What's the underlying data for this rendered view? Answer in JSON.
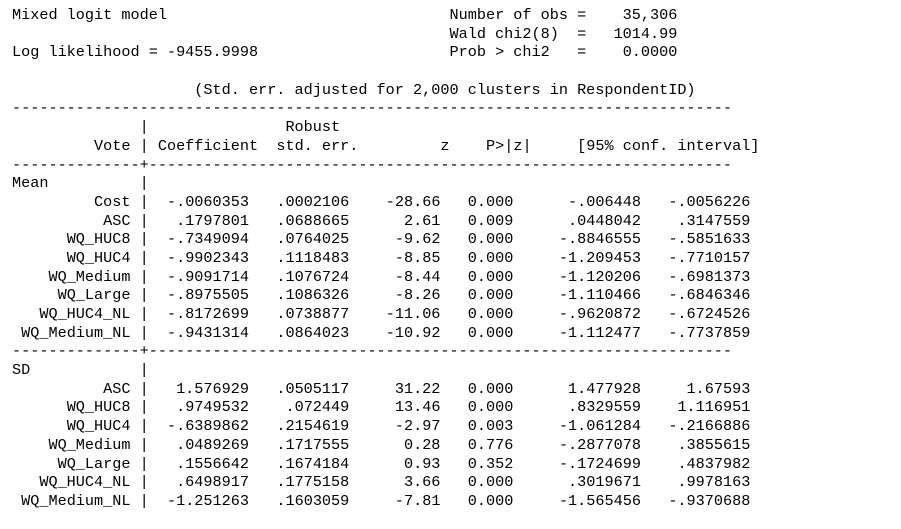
{
  "header": {
    "model_title": "Mixed logit model",
    "log_likelihood_label": "Log likelihood",
    "log_likelihood_value": "-9455.9998",
    "stats": [
      {
        "label": "Number of obs",
        "value": "35,306"
      },
      {
        "label": "Wald chi2(8)",
        "value": "1014.99"
      },
      {
        "label": "Prob > chi2",
        "value": "0.0000"
      }
    ],
    "cluster_note": "(Std. err. adjusted for 2,000 clusters in RespondentID)"
  },
  "table": {
    "depvar": "Vote",
    "col_headers": {
      "coef": "Coefficient",
      "robust": "Robust",
      "se": "std. err.",
      "z": "z",
      "p": "P>|z|",
      "ci": "[95% conf. interval]"
    },
    "sections": [
      {
        "name": "Mean",
        "rows": [
          {
            "var": "Cost",
            "coef": "-.0060353",
            "se": ".0002106",
            "z": "-28.66",
            "p": "0.000",
            "lo": "-.006448",
            "hi": "-.0056226"
          },
          {
            "var": "ASC",
            "coef": ".1797801",
            "se": ".0688665",
            "z": "2.61",
            "p": "0.009",
            "lo": ".0448042",
            "hi": ".3147559"
          },
          {
            "var": "WQ_HUC8",
            "coef": "-.7349094",
            "se": ".0764025",
            "z": "-9.62",
            "p": "0.000",
            "lo": "-.8846555",
            "hi": "-.5851633"
          },
          {
            "var": "WQ_HUC4",
            "coef": "-.9902343",
            "se": ".1118483",
            "z": "-8.85",
            "p": "0.000",
            "lo": "-1.209453",
            "hi": "-.7710157"
          },
          {
            "var": "WQ_Medium",
            "coef": "-.9091714",
            "se": ".1076724",
            "z": "-8.44",
            "p": "0.000",
            "lo": "-1.120206",
            "hi": "-.6981373"
          },
          {
            "var": "WQ_Large",
            "coef": "-.8975505",
            "se": ".1086326",
            "z": "-8.26",
            "p": "0.000",
            "lo": "-1.110466",
            "hi": "-.6846346"
          },
          {
            "var": "WQ_HUC4_NL",
            "coef": "-.8172699",
            "se": ".0738877",
            "z": "-11.06",
            "p": "0.000",
            "lo": "-.9620872",
            "hi": "-.6724526"
          },
          {
            "var": "WQ_Medium_NL",
            "coef": "-.9431314",
            "se": ".0864023",
            "z": "-10.92",
            "p": "0.000",
            "lo": "-1.112477",
            "hi": "-.7737859"
          }
        ]
      },
      {
        "name": "SD",
        "rows": [
          {
            "var": "ASC",
            "coef": "1.576929",
            "se": ".0505117",
            "z": "31.22",
            "p": "0.000",
            "lo": "1.477928",
            "hi": "1.67593"
          },
          {
            "var": "WQ_HUC8",
            "coef": ".9749532",
            "se": ".072449",
            "z": "13.46",
            "p": "0.000",
            "lo": ".8329559",
            "hi": "1.116951"
          },
          {
            "var": "WQ_HUC4",
            "coef": "-.6389862",
            "se": ".2154619",
            "z": "-2.97",
            "p": "0.003",
            "lo": "-1.061284",
            "hi": "-.2166886"
          },
          {
            "var": "WQ_Medium",
            "coef": ".0489269",
            "se": ".1717555",
            "z": "0.28",
            "p": "0.776",
            "lo": "-.2877078",
            "hi": ".3855615"
          },
          {
            "var": "WQ_Large",
            "coef": ".1556642",
            "se": ".1674184",
            "z": "0.93",
            "p": "0.352",
            "lo": "-.1724699",
            "hi": ".4837982"
          },
          {
            "var": "WQ_HUC4_NL",
            "coef": ".6498917",
            "se": ".1775158",
            "z": "3.66",
            "p": "0.000",
            "lo": ".3019671",
            "hi": ".9978163"
          },
          {
            "var": "WQ_Medium_NL",
            "coef": "-1.251263",
            "se": ".1603059",
            "z": "-7.81",
            "p": "0.000",
            "lo": "-1.565456",
            "hi": "-.9370688"
          }
        ]
      }
    ]
  }
}
